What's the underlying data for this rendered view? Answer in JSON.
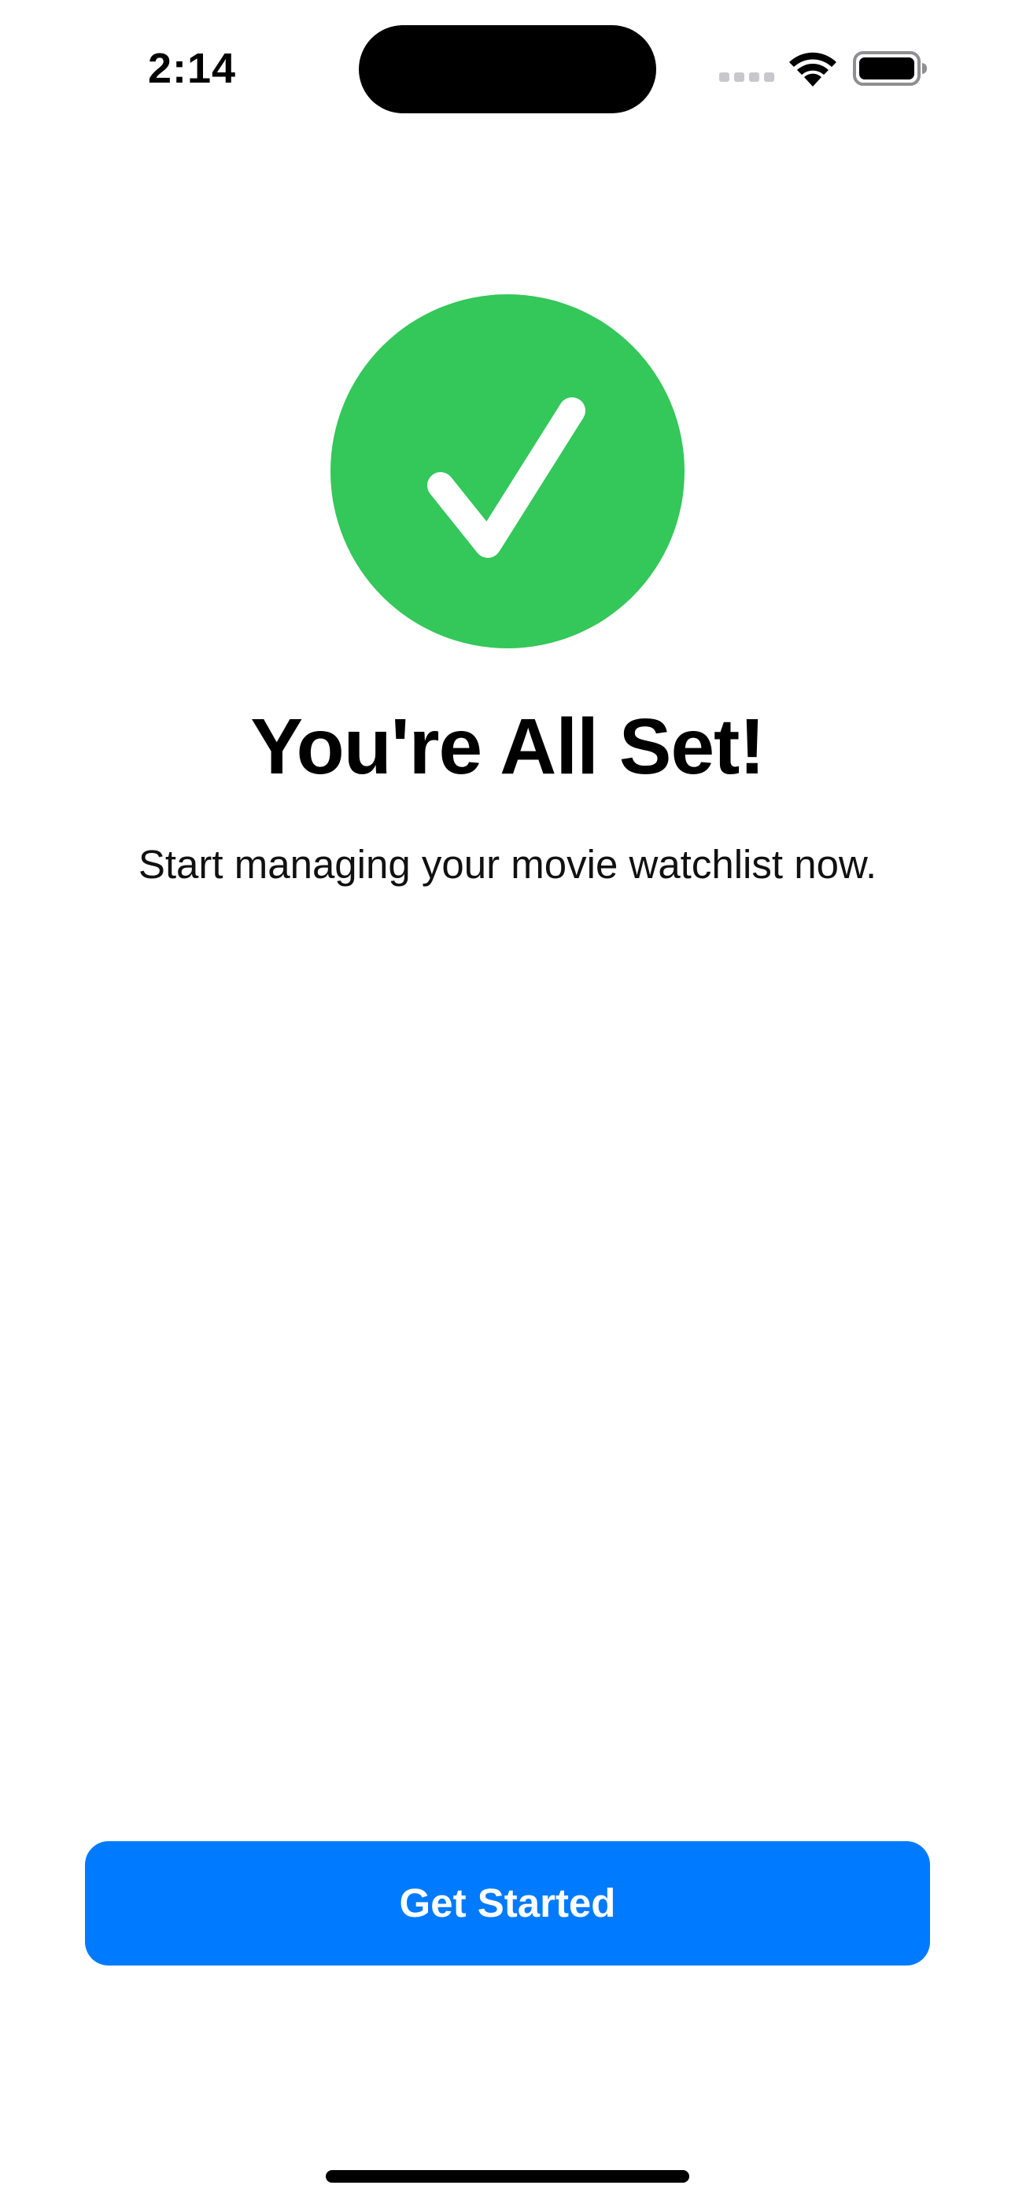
{
  "status_bar": {
    "time": "2:14",
    "signal_icon": "cellular-signal-icon",
    "wifi_icon": "wifi-icon",
    "battery_icon": "battery-icon"
  },
  "colors": {
    "success_green": "#34c759",
    "accent_blue": "#007aff",
    "background": "#ffffff",
    "text": "#000000"
  },
  "main": {
    "badge_icon": "checkmark-icon",
    "title": "You're All Set!",
    "subtitle": "Start managing your movie watchlist now."
  },
  "actions": {
    "primary_label": "Get Started"
  }
}
